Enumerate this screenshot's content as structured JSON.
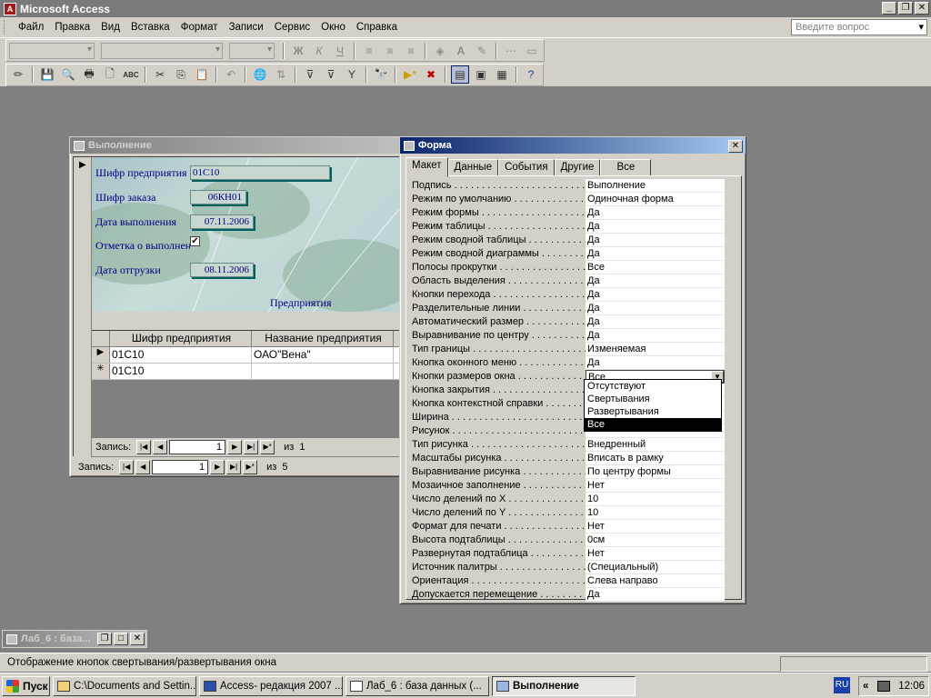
{
  "app": {
    "title": "Microsoft Access",
    "logo_text": "A"
  },
  "menu": [
    "Файл",
    "Правка",
    "Вид",
    "Вставка",
    "Формат",
    "Записи",
    "Сервис",
    "Окно",
    "Справка"
  ],
  "ask_placeholder": "Введите вопрос",
  "toolbar": {
    "bold": "Ж",
    "italic": "К",
    "underline": "Ч",
    "font_color": "A"
  },
  "form_window": {
    "title": "Выполнение",
    "fields": [
      {
        "label": "Шифр предприятия",
        "value": "01С10"
      },
      {
        "label": "Шифр заказа",
        "value": "06КН01"
      },
      {
        "label": "Дата выполнения",
        "value": "07.11.2006"
      },
      {
        "label": "Отметка о выполнен",
        "checked": true
      },
      {
        "label": "Дата отгрузки",
        "value": "08.11.2006"
      }
    ],
    "check_mark": "✔",
    "subform_caption": "Предприятия",
    "subform": {
      "columns": [
        "Шифр предприятия",
        "Название предприятия"
      ],
      "rows": [
        {
          "marker": "▶",
          "cells": [
            "01С10",
            "ОАО\"Вена\""
          ]
        },
        {
          "marker": "✳",
          "cells": [
            "01С10",
            ""
          ]
        }
      ],
      "nav": {
        "label": "Запись:",
        "current": "1",
        "of": "из",
        "total": "1"
      }
    },
    "nav": {
      "label": "Запись:",
      "current": "1",
      "of": "из",
      "total": "5"
    }
  },
  "prop_sheet": {
    "title": "Форма",
    "tabs": [
      "Макет",
      "Данные",
      "События",
      "Другие",
      "Все"
    ],
    "rows": [
      {
        "name": "Подпись",
        "value": "Выполнение"
      },
      {
        "name": "Режим по умолчанию",
        "value": "Одиночная форма"
      },
      {
        "name": "Режим формы",
        "value": "Да"
      },
      {
        "name": "Режим таблицы",
        "value": "Да"
      },
      {
        "name": "Режим сводной таблицы",
        "value": "Да"
      },
      {
        "name": "Режим сводной диаграммы",
        "value": "Да"
      },
      {
        "name": "Полосы прокрутки",
        "value": "Все"
      },
      {
        "name": "Область выделения",
        "value": "Да"
      },
      {
        "name": "Кнопки перехода",
        "value": "Да"
      },
      {
        "name": "Разделительные линии",
        "value": "Да"
      },
      {
        "name": "Автоматический размер",
        "value": "Да"
      },
      {
        "name": "Выравнивание по центру",
        "value": "Да"
      },
      {
        "name": "Тип границы",
        "value": "Изменяемая"
      },
      {
        "name": "Кнопка оконного меню",
        "value": "Да"
      },
      {
        "name": "Кнопки размеров окна",
        "value": "Все"
      },
      {
        "name": "Кнопка закрытия",
        "value": ""
      },
      {
        "name": "Кнопка контекстной справки",
        "value": ""
      },
      {
        "name": "Ширина",
        "value": ""
      },
      {
        "name": "Рисунок",
        "value": ""
      },
      {
        "name": "Тип рисунка",
        "value": "Внедренный"
      },
      {
        "name": "Масштабы рисунка",
        "value": "Вписать в рамку"
      },
      {
        "name": "Выравнивание рисунка",
        "value": "По центру формы"
      },
      {
        "name": "Мозаичное заполнение",
        "value": "Нет"
      },
      {
        "name": "Число делений по X",
        "value": "10"
      },
      {
        "name": "Число делений по Y",
        "value": "10"
      },
      {
        "name": "Формат для печати",
        "value": "Нет"
      },
      {
        "name": "Высота подтаблицы",
        "value": "0см"
      },
      {
        "name": "Развернутая подтаблица",
        "value": "Нет"
      },
      {
        "name": "Источник палитры",
        "value": "(Специальный)"
      },
      {
        "name": "Ориентация",
        "value": "Слева направо"
      },
      {
        "name": "Допускается перемещение",
        "value": "Да"
      }
    ],
    "dropdown_options": [
      "Отсутствуют",
      "Свертывания",
      "Развертывания",
      "Все"
    ],
    "dropdown_selected": 3
  },
  "minimized_window": {
    "title": "Лаб_6 : база..."
  },
  "status_text": "Отображение кнопок свертывания/развертывания окна",
  "taskbar": {
    "start": "Пуск",
    "buttons": [
      {
        "label": "C:\\Documents and Settin...",
        "icon": "folder-icon"
      },
      {
        "label": "Access- редакция 2007 ...",
        "icon": "word-doc-icon"
      },
      {
        "label": "Лаб_6 : база данных (...",
        "icon": "database-icon"
      },
      {
        "label": "Выполнение",
        "icon": "form-icon"
      }
    ],
    "lang": "RU",
    "tray_arrow": "«",
    "clock": "12:06"
  },
  "colors": {
    "active_caption": "#0a246a",
    "face": "#d4d0c8",
    "desktop": "#808080",
    "form_label": "#000080"
  }
}
